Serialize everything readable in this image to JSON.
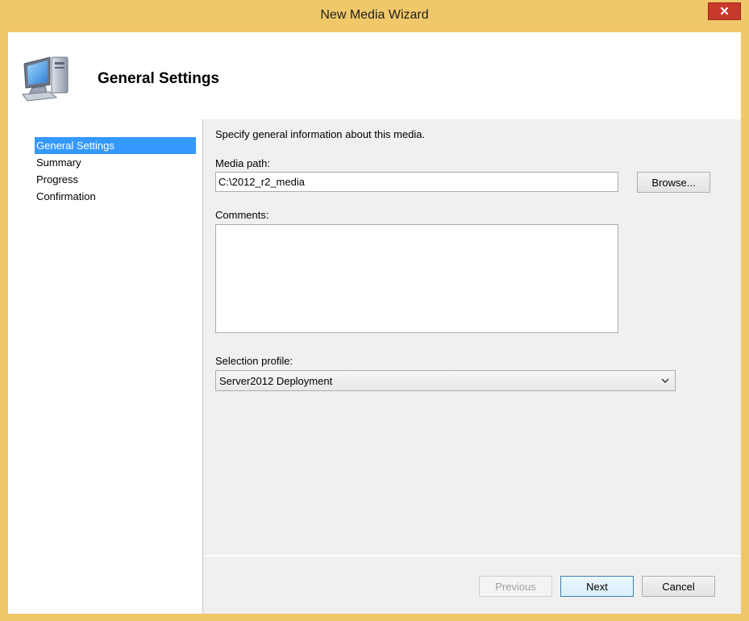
{
  "window": {
    "title": "New Media Wizard",
    "close_label": "✕"
  },
  "header": {
    "title": "General Settings",
    "icon": "computer-icon"
  },
  "nav": {
    "items": [
      {
        "label": "General Settings",
        "selected": true
      },
      {
        "label": "Summary",
        "selected": false
      },
      {
        "label": "Progress",
        "selected": false
      },
      {
        "label": "Confirmation",
        "selected": false
      }
    ]
  },
  "form": {
    "instruction": "Specify general information about this media.",
    "media_path_label": "Media path:",
    "media_path_value": "C:\\2012_r2_media",
    "browse_label": "Browse...",
    "comments_label": "Comments:",
    "comments_value": "",
    "selection_profile_label": "Selection profile:",
    "selection_profile_value": "Server2012 Deployment"
  },
  "footer": {
    "previous_label": "Previous",
    "next_label": "Next",
    "cancel_label": "Cancel"
  },
  "colors": {
    "frame": "#f0c86a",
    "close": "#c7392b",
    "selection": "#3399ff"
  }
}
